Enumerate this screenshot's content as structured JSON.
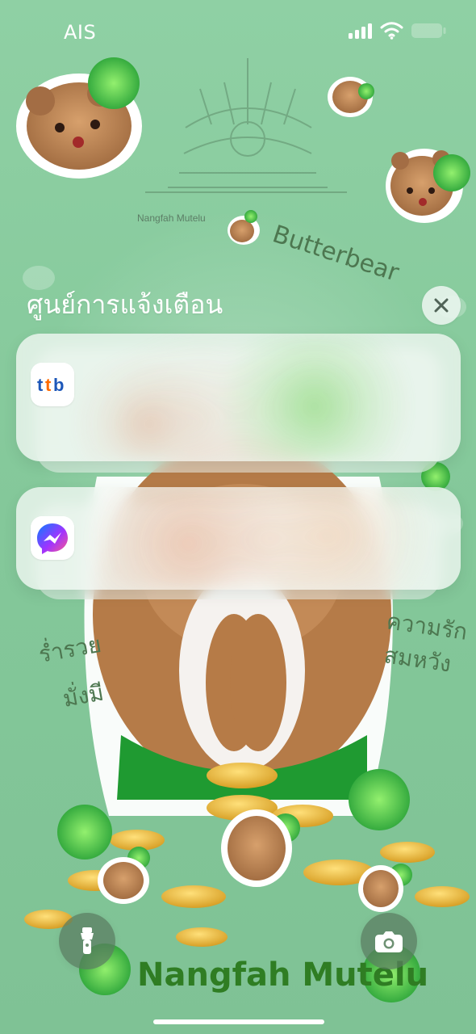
{
  "status_bar": {
    "carrier": "AIS"
  },
  "notification_center": {
    "title": "ศูนย์การแจ้งเตือน",
    "notifications": [
      {
        "app_icon": "ttb-app-icon"
      },
      {
        "app_icon": "messenger-app-icon"
      }
    ]
  },
  "wallpaper": {
    "text_top": "Nangfah Mutelu",
    "text_butterbear": "Butterbear",
    "text_left": "ร่ำรวย\nมั่งมี",
    "text_right": "ความรัก\nสมหวัง",
    "text_bottom": "Nangfah Mutelu"
  },
  "icons": {
    "signal": "signal-icon",
    "wifi": "wifi-icon",
    "battery": "battery-icon",
    "close": "close-icon",
    "flashlight": "flashlight-icon",
    "camera": "camera-icon"
  },
  "colors": {
    "background_green": "#86c99a",
    "accent_green": "#34c759",
    "text_white": "#ffffff",
    "ttb_blue": "#1f6fd1",
    "ttb_orange": "#ff6a00"
  }
}
